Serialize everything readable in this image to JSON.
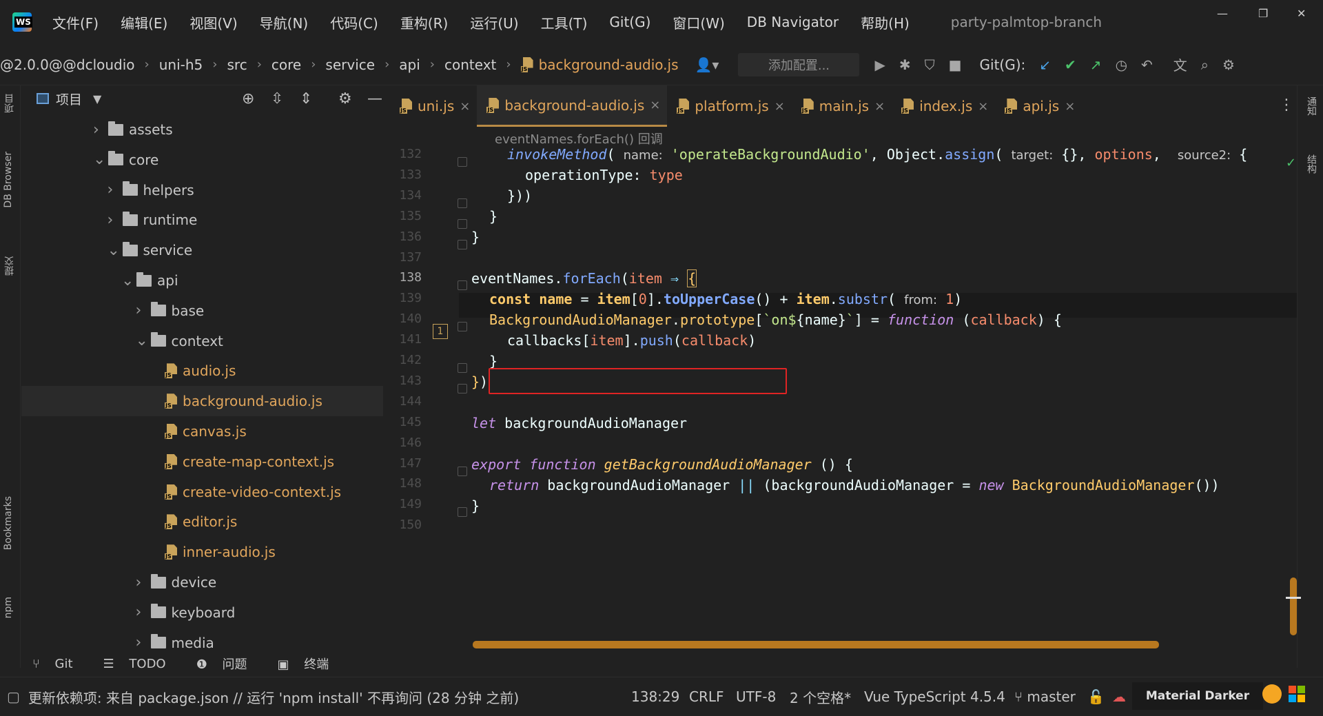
{
  "menubar": {
    "items": [
      "文件(F)",
      "编辑(E)",
      "视图(V)",
      "导航(N)",
      "代码(C)",
      "重构(R)",
      "运行(U)",
      "工具(T)",
      "Git(G)",
      "窗口(W)",
      "DB Navigator",
      "帮助(H)"
    ],
    "project_title": "party-palmtop-branch"
  },
  "navbar": {
    "breadcrumbs": [
      "@2.0.0@@dcloudio",
      "uni-h5",
      "src",
      "core",
      "service",
      "api",
      "context",
      "background-audio.js"
    ],
    "run_config_placeholder": "添加配置...",
    "git_label": "Git(G):"
  },
  "left_strip": {
    "labels": [
      "项目",
      "DB Browser",
      "提交",
      "Bookmarks",
      "npm"
    ]
  },
  "right_strip": {
    "labels": [
      "通知",
      "结构"
    ]
  },
  "project_panel": {
    "title": "项目",
    "tree": [
      {
        "label": "assets",
        "depth": 0,
        "type": "folder",
        "expanded": false
      },
      {
        "label": "core",
        "depth": 0,
        "type": "folder",
        "expanded": true
      },
      {
        "label": "helpers",
        "depth": 1,
        "type": "folder",
        "expanded": false
      },
      {
        "label": "runtime",
        "depth": 1,
        "type": "folder",
        "expanded": false
      },
      {
        "label": "service",
        "depth": 1,
        "type": "folder",
        "expanded": true
      },
      {
        "label": "api",
        "depth": 2,
        "type": "folder",
        "expanded": true
      },
      {
        "label": "base",
        "depth": 3,
        "type": "folder",
        "expanded": false
      },
      {
        "label": "context",
        "depth": 3,
        "type": "folder",
        "expanded": true
      },
      {
        "label": "audio.js",
        "depth": 4,
        "type": "file"
      },
      {
        "label": "background-audio.js",
        "depth": 4,
        "type": "file",
        "selected": true
      },
      {
        "label": "canvas.js",
        "depth": 4,
        "type": "file"
      },
      {
        "label": "create-map-context.js",
        "depth": 4,
        "type": "file"
      },
      {
        "label": "create-video-context.js",
        "depth": 4,
        "type": "file"
      },
      {
        "label": "editor.js",
        "depth": 4,
        "type": "file"
      },
      {
        "label": "inner-audio.js",
        "depth": 4,
        "type": "file"
      },
      {
        "label": "device",
        "depth": 3,
        "type": "folder",
        "expanded": false
      },
      {
        "label": "keyboard",
        "depth": 3,
        "type": "folder",
        "expanded": false
      },
      {
        "label": "media",
        "depth": 3,
        "type": "folder",
        "expanded": false
      }
    ]
  },
  "editor": {
    "tabs": [
      {
        "label": "uni.js",
        "active": false
      },
      {
        "label": "background-audio.js",
        "active": true
      },
      {
        "label": "platform.js",
        "active": false
      },
      {
        "label": "main.js",
        "active": false
      },
      {
        "label": "index.js",
        "active": false
      },
      {
        "label": "api.js",
        "active": false
      }
    ],
    "sticky_crumb": "eventNames.forEach() 回调",
    "line_numbers": [
      "132",
      "133",
      "134",
      "135",
      "136",
      "137",
      "138",
      "139",
      "140",
      "141",
      "142",
      "143",
      "144",
      "145",
      "146",
      "147",
      "148",
      "149",
      "150"
    ],
    "current_line": "138",
    "badge_139": "1",
    "hints": {
      "name": "name:",
      "target": "target:",
      "source2": "source2:",
      "from": "from:"
    }
  },
  "bottom_tabs": [
    "Git",
    "TODO",
    "问题",
    "终端"
  ],
  "status_bar": {
    "message": "更新依赖项: 来自 package.json // 运行 'npm install'   不再询问 (28 分钟 之前)",
    "position": "138:29",
    "line_sep": "CRLF",
    "encoding": "UTF-8",
    "indent": "2 个空格*",
    "language": "Vue TypeScript 4.5.4",
    "branch": "master",
    "theme": "Material Darker"
  },
  "colors": {
    "accent_orange": "#b8781f",
    "highlight_box": "#e02424",
    "file_text": "#e1a65c"
  }
}
